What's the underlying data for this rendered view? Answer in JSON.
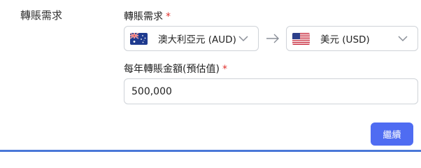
{
  "section": {
    "title": "轉賬需求"
  },
  "transfer": {
    "label": "轉賬需求",
    "required_mark": "*",
    "from": {
      "currency_label": "澳大利亞元 (AUD)",
      "flag": "australia-flag-icon"
    },
    "to": {
      "currency_label": "美元 (USD)",
      "flag": "us-flag-icon"
    }
  },
  "amount": {
    "label": "每年轉賬金額(預估值)",
    "required_mark": "*",
    "value": "500,000"
  },
  "actions": {
    "continue_label": "繼續"
  },
  "colors": {
    "accent": "#4f6cf2",
    "required": "#e0312d",
    "border": "#cfd3d8",
    "bottom_line": "#4a78d8"
  }
}
